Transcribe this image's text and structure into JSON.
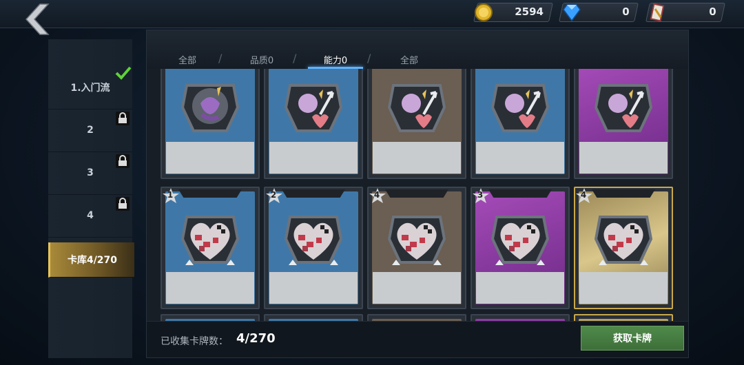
{
  "topbar": {
    "resources": [
      {
        "name": "coin",
        "icon": "gold-coin-icon",
        "value": "2594"
      },
      {
        "name": "diamond",
        "icon": "diamond-icon",
        "value": "0"
      },
      {
        "name": "ticket",
        "icon": "ticket-icon",
        "value": "0"
      }
    ]
  },
  "sidebar": {
    "items": [
      {
        "label": "1.入门流",
        "status": "checked"
      },
      {
        "label": "2",
        "status": "locked"
      },
      {
        "label": "3",
        "status": "locked"
      },
      {
        "label": "4",
        "status": "locked"
      },
      {
        "label": "卡库4/270",
        "status": "active"
      }
    ]
  },
  "tabs": [
    {
      "label": "全部"
    },
    {
      "label": "品质0"
    },
    {
      "label": "能力0"
    },
    {
      "label": "全部"
    }
  ],
  "active_tab_index": 2,
  "cards_row1": [
    {
      "bg": "blue",
      "icon": "shield-creature-icon"
    },
    {
      "bg": "blue",
      "icon": "skull-arrow-heart-icon"
    },
    {
      "bg": "brown",
      "icon": "skull-arrow-heart-icon"
    },
    {
      "bg": "blue",
      "icon": "skull-arrow-heart-icon"
    },
    {
      "bg": "purple",
      "icon": "skull-arrow-heart-icon"
    }
  ],
  "cards_row2": [
    {
      "bg": "blue",
      "level": "1",
      "icon": "broken-heart-icon"
    },
    {
      "bg": "blue",
      "level": "2",
      "icon": "broken-heart-icon"
    },
    {
      "bg": "brown",
      "level": "4",
      "icon": "broken-heart-icon"
    },
    {
      "bg": "purple",
      "level": "3",
      "icon": "broken-heart-icon"
    },
    {
      "bg": "gold",
      "level": "4",
      "icon": "broken-heart-icon"
    }
  ],
  "colors": {
    "blue": "#3f78a8",
    "brown": "#6b5e52",
    "purple": "#8e3aa6",
    "gold": "#b7a163",
    "tab_active": "#5fb3ff",
    "button_green": "#4a8444"
  },
  "footer": {
    "collected_label": "已收集卡牌数：",
    "collected_value": "4/270",
    "get_button": "获取卡牌"
  }
}
